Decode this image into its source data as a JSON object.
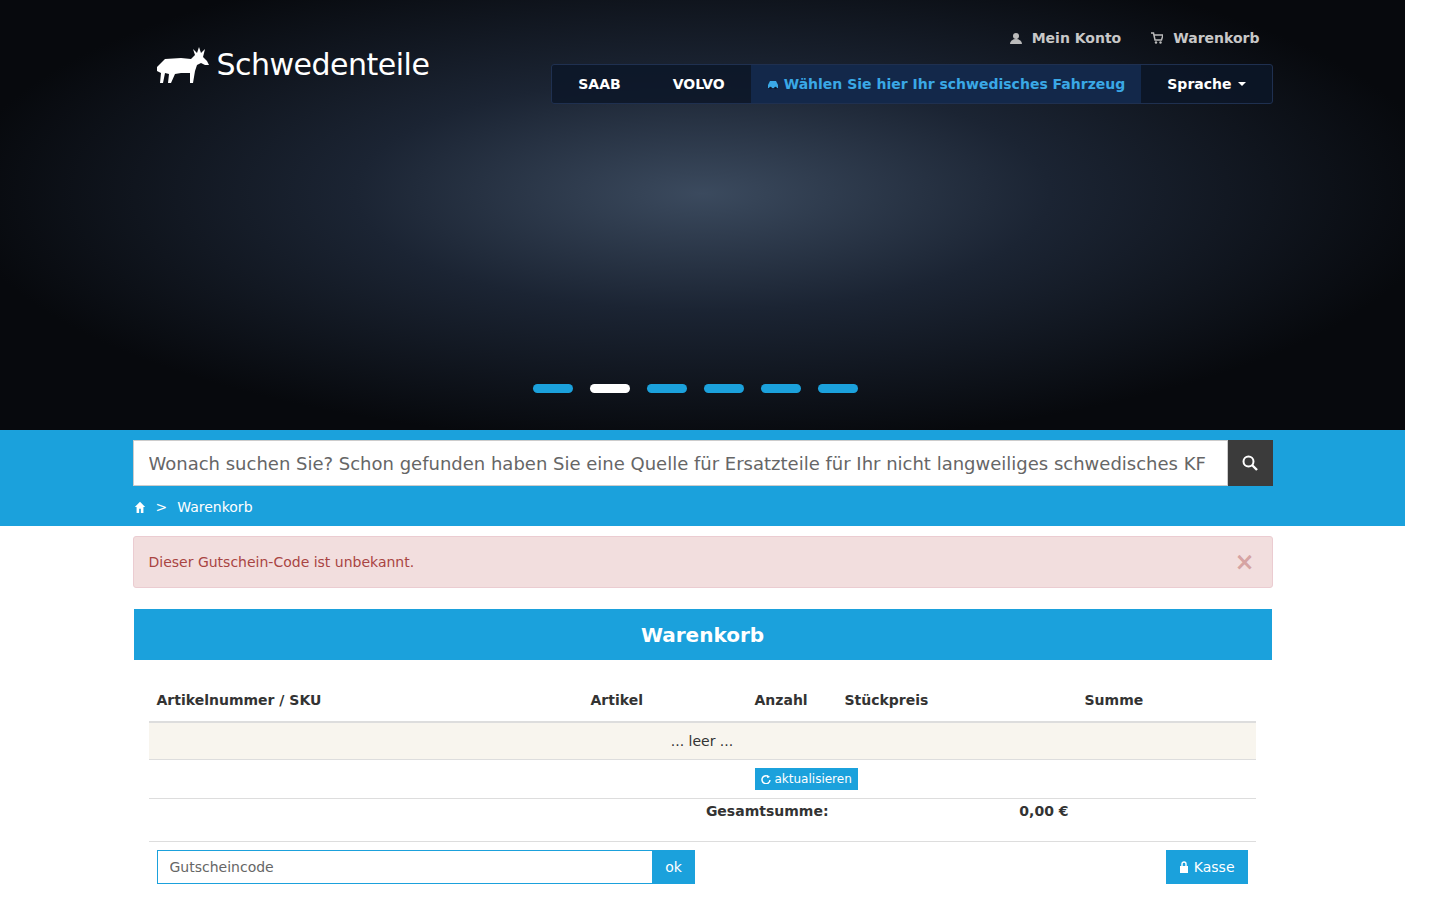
{
  "logo": {
    "text": "Schwedenteile"
  },
  "top_links": [
    {
      "label": "Mein Konto"
    },
    {
      "label": "Warenkorb"
    }
  ],
  "nav": {
    "items": [
      {
        "label": "SAAB",
        "kind": "link"
      },
      {
        "label": "VOLVO",
        "kind": "link"
      },
      {
        "label": "Wählen Sie hier Ihr schwedisches Fahrzeug",
        "kind": "vehicle"
      },
      {
        "label": "Sprache",
        "kind": "dropdown"
      }
    ]
  },
  "carousel": {
    "slides": [
      {
        "selected": false
      },
      {
        "selected": true
      },
      {
        "selected": false
      },
      {
        "selected": false
      },
      {
        "selected": false
      },
      {
        "selected": false
      }
    ]
  },
  "search": {
    "placeholder": "Wonach suchen Sie? Schon gefunden haben Sie eine Quelle für Ersatzteile für Ihr nicht langweiliges schwedisches KF"
  },
  "breadcrumb": {
    "separator": ">",
    "items": [
      "Warenkorb"
    ]
  },
  "alert": {
    "message": "Dieser Gutschein-Code ist unbekannt.",
    "close": "×"
  },
  "cart": {
    "title": "Warenkorb",
    "columns": [
      "Artikelnummer / SKU",
      "Artikel",
      "Anzahl",
      "Stückpreis",
      "Summe"
    ],
    "empty": "... leer ...",
    "update_button": "aktualisieren",
    "total_label": "Gesamtsumme:",
    "total": "0,00 €"
  },
  "coupon": {
    "placeholder": "Gutscheincode",
    "button": "ok"
  },
  "checkout": {
    "label": "Kasse"
  }
}
